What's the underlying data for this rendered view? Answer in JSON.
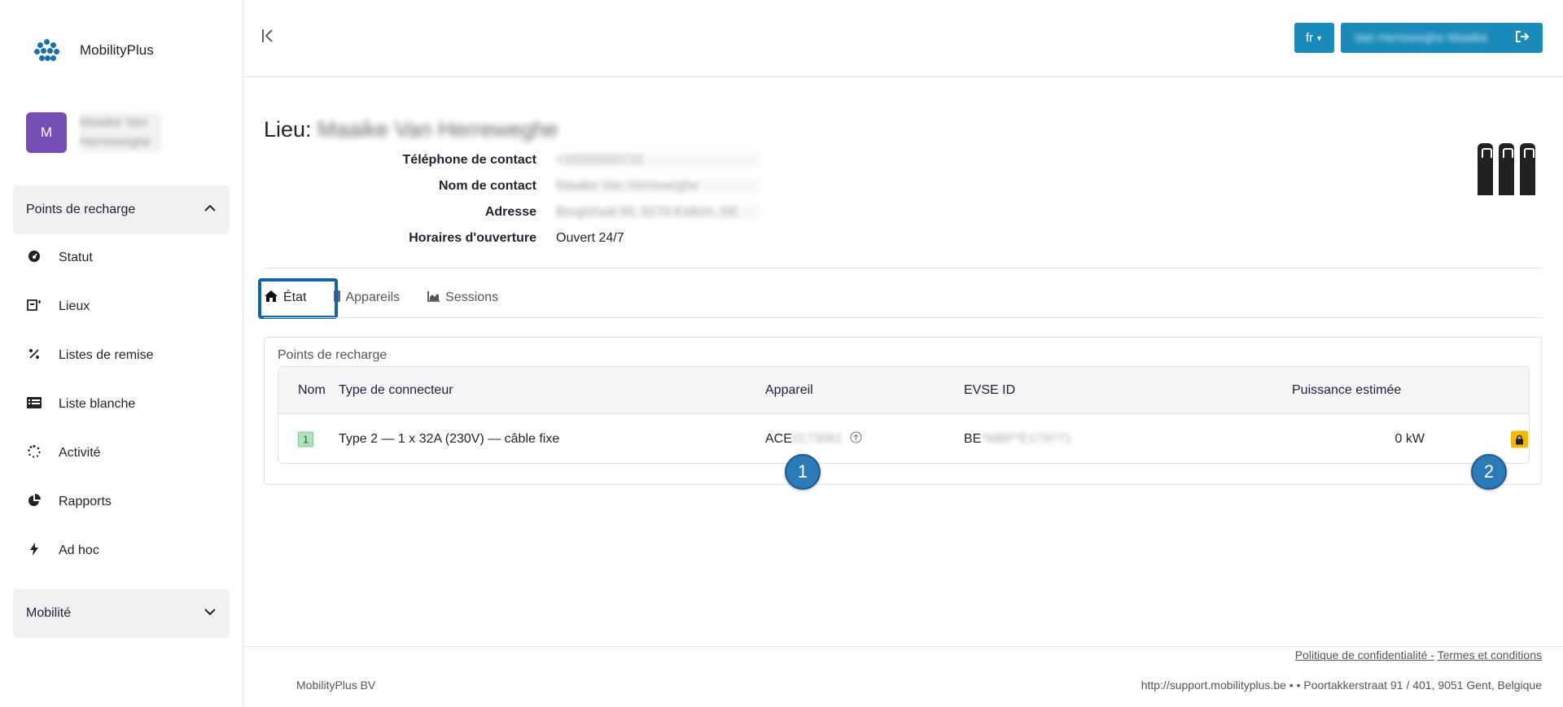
{
  "brand": {
    "name": "MobilityPlus"
  },
  "user": {
    "initial": "M",
    "name": "Maaike Van Herreweghe"
  },
  "sidebar": {
    "group_charging": "Points de recharge",
    "items": [
      {
        "label": "Statut",
        "icon": "dashboard-icon"
      },
      {
        "label": "Lieux",
        "icon": "location-icon"
      },
      {
        "label": "Listes de remise",
        "icon": "percent-icon"
      },
      {
        "label": "Liste blanche",
        "icon": "list-icon"
      },
      {
        "label": "Activité",
        "icon": "spinner-icon"
      },
      {
        "label": "Rapports",
        "icon": "pie-chart-icon"
      },
      {
        "label": "Ad hoc",
        "icon": "bolt-icon"
      }
    ],
    "group_mobility": "Mobilité"
  },
  "header": {
    "lang": "fr",
    "user_button": "Van Herreweghe Maaike"
  },
  "location": {
    "title_prefix": "Lieu:",
    "title_name": "Maaike Van Herreweghe",
    "fields": [
      {
        "label": "Téléphone de contact",
        "value": "+32000000732",
        "blurred": true
      },
      {
        "label": "Nom de contact",
        "value": "Maaike Van Herreweghe",
        "blurred": true
      },
      {
        "label": "Adresse",
        "value": "Brugstraat 66, 9270 Kalken, BE",
        "blurred": true
      },
      {
        "label": "Horaires d'ouverture",
        "value": "Ouvert 24/7",
        "blurred": false
      }
    ]
  },
  "tabs": [
    {
      "label": "État",
      "icon": "home-icon"
    },
    {
      "label": "Appareils",
      "icon": "device-icon"
    },
    {
      "label": "Sessions",
      "icon": "area-chart-icon"
    }
  ],
  "card": {
    "title": "Points de recharge",
    "columns": {
      "name": "Nom",
      "connector": "Type de connecteur",
      "device": "Appareil",
      "evse": "EVSE ID",
      "power": "Puissance estimée"
    },
    "rows": [
      {
        "num": "1",
        "connector": "Type 2 — 1 x 32A (230V) — câble fixe",
        "device_prefix": "ACE",
        "device_rest": "0173061",
        "evse_prefix": "BE",
        "evse_rest": "*MBP*E179771",
        "power": "0 kW"
      }
    ]
  },
  "markers": {
    "m1": "1",
    "m2": "2"
  },
  "footer": {
    "privacy": "Politique de confidentialité ",
    "separator": "-",
    "terms": "Termes et conditions",
    "company": "MobilityPlus BV",
    "address": "http://support.mobilityplus.be • • Poortakkerstraat 91 / 401, 9051 Gent, Belgique"
  },
  "colors": {
    "accent": "#1a8bb9",
    "avatar": "#7450b4",
    "highlight": "#1063a9",
    "lock_button": "#f5b800",
    "bolt_button": "#1f2a55"
  }
}
